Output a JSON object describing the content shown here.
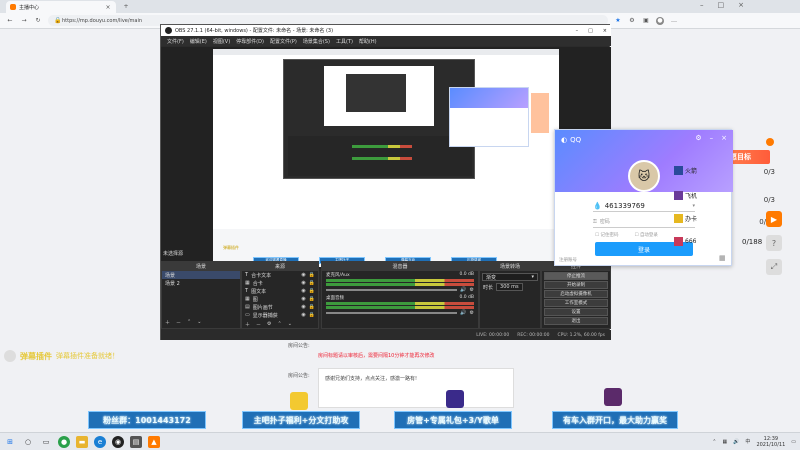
{
  "browser": {
    "tab_title": "主播中心",
    "url": "https://mp.douyu.com/live/main",
    "new_tab_icon": "plus-icon"
  },
  "obs": {
    "title": "OBS 27.1.1 (64-bit, windows) - 配置文件: 未命名 - 场景: 未命名 (3)",
    "menu": [
      "文件(F)",
      "编辑(E)",
      "视图(V)",
      "停靠部件(D)",
      "配置文件(P)",
      "场景集合(S)",
      "工具(T)",
      "帮助(H)"
    ],
    "no_source_selected": "未选择源",
    "scenes_title": "场景",
    "scenes": [
      "场景",
      "场景 2"
    ],
    "sources_title": "来源",
    "sources": [
      "合卡文本",
      "合卡",
      "图文本",
      "图",
      "图片画节",
      "显示器捕获"
    ],
    "mixer_title": "混音器",
    "mixer": [
      {
        "name": "麦克风/Aux",
        "db": "0.0 dB"
      },
      {
        "name": "桌面音频",
        "db": "0.0 dB"
      }
    ],
    "transitions_title": "场景转场",
    "transition": "渐变",
    "duration_label": "时长",
    "duration_value": "300 ms",
    "controls_title": "控件",
    "controls": [
      "停止推流",
      "开始录制",
      "启动虚拟摄像机",
      "工作室模式",
      "设置",
      "退出"
    ],
    "status": {
      "live": "LIVE: 00:00:00",
      "rec": "REC: 00:00:00",
      "cpu": "CPU: 1.2%, 60.00 fps"
    },
    "preview_banners": [
      "欢迎观看直播",
      "主吧扑子",
      "弹幕互动",
      "礼物感谢"
    ]
  },
  "qq": {
    "brand": "QQ",
    "account": "461339769",
    "password_placeholder": "密码",
    "remember": "记住密码",
    "auto_login": "自动登录",
    "login": "登录",
    "register": "注册账号",
    "accent": "#1b9cfc"
  },
  "right_panel": {
    "title_badge": "今日心愿目标",
    "items": [
      {
        "icon": "飞机",
        "count": "0/3"
      },
      {
        "icon": "火箭",
        "count": "0/3"
      },
      {
        "icon": "办卡",
        "count": "0/16"
      },
      {
        "icon": "666",
        "count": "0/188"
      }
    ]
  },
  "page": {
    "plugin_label": "弹幕插件",
    "plugin_note": "弹幕插件准备就绪！",
    "notice_label": "房间公告:",
    "notice_text": "感谢兄弟们支持，点点关注，感激一路有!",
    "announce_label": "房间公告:",
    "red_note": "房间标题请以审核后，需要间隔10分钟才能再次修改"
  },
  "banners": [
    "粉丝群：1001443172",
    "主吧扑子福利+分文打助攻",
    "房管+专属礼包+3/Y歌单",
    "有车入群开口，最大助力赢奖"
  ],
  "taskbar": {
    "time": "12:39",
    "date": "2021/10/11"
  }
}
